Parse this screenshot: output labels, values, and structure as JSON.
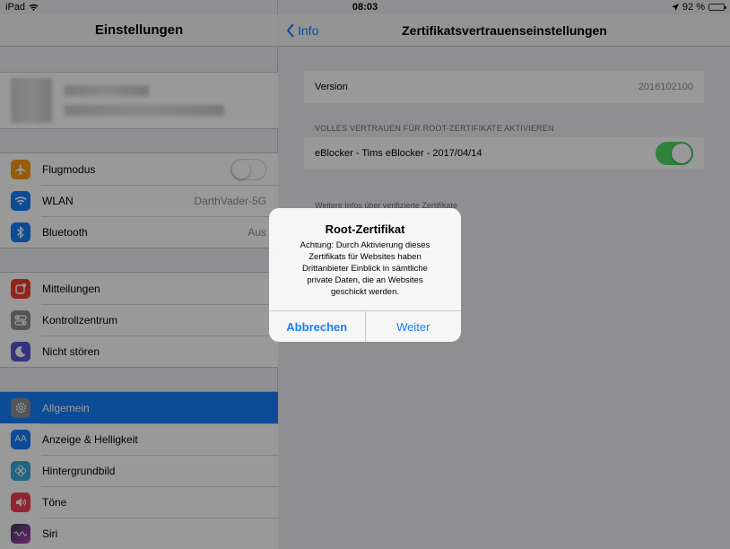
{
  "status_bar": {
    "device": "iPad",
    "time": "08:03",
    "battery": "92 %",
    "battery_level": 0.92
  },
  "sidebar": {
    "title": "Einstellungen",
    "groups": [
      [
        {
          "label": "Flugmodus",
          "icon": "airplane-icon",
          "color": "#f89a12",
          "control": "toggle-off"
        },
        {
          "label": "WLAN",
          "icon": "wifi-icon",
          "color": "#147efb",
          "value": "DarthVader-5G"
        },
        {
          "label": "Bluetooth",
          "icon": "bluetooth-icon",
          "color": "#147efb",
          "value": "Aus"
        }
      ],
      [
        {
          "label": "Mitteilungen",
          "icon": "notifications-icon",
          "color": "#f33b30"
        },
        {
          "label": "Kontrollzentrum",
          "icon": "control-center-icon",
          "color": "#8e8e93"
        },
        {
          "label": "Nicht stören",
          "icon": "moon-icon",
          "color": "#5856d6"
        }
      ],
      [
        {
          "label": "Allgemein",
          "icon": "gear-icon",
          "color": "#8e8e93",
          "selected": true
        },
        {
          "label": "Anzeige & Helligkeit",
          "icon": "display-icon",
          "color": "#147efb",
          "glyph": "AA"
        },
        {
          "label": "Hintergrundbild",
          "icon": "wallpaper-icon",
          "color": "#36aadc"
        },
        {
          "label": "Töne",
          "icon": "sounds-icon",
          "color": "#f33b57"
        },
        {
          "label": "Siri",
          "icon": "siri-icon",
          "color": "#3b3b5c"
        }
      ]
    ]
  },
  "main": {
    "back_label": "Info",
    "title": "Zertifikatsvertrauenseinstellungen",
    "version_label": "Version",
    "version_value": "2016102100",
    "section_header": "VOLLES VERTRAUEN FÜR ROOT-ZERTIFIKATE AKTIVIEREN",
    "certificate_label": "eBlocker - Tims eBlocker - 2017/04/14",
    "certificate_trusted": true,
    "footer": "Weitere Infos über verifizierte Zertifikate"
  },
  "alert": {
    "title": "Root-Zertifikat",
    "message": "Achtung: Durch Aktivierung dieses\nZertifikats für Websites haben\nDrittanbieter Einblick in sämtliche\nprivate Daten, die an Websites\ngeschickt werden.",
    "cancel_label": "Abbrechen",
    "continue_label": "Weiter"
  },
  "colors": {
    "accent": "#157efb",
    "toggle_on": "#4cd964",
    "overlay": "rgba(0,0,0,0.40)"
  }
}
